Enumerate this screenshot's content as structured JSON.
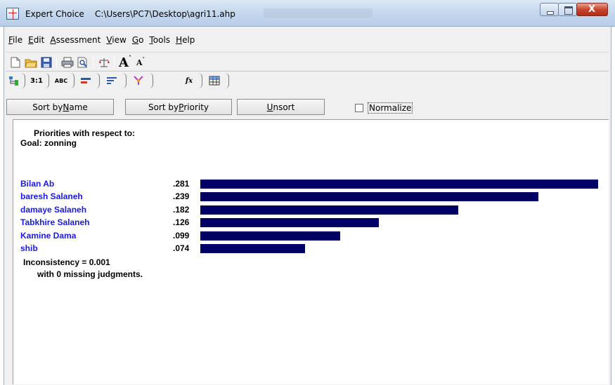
{
  "window": {
    "app_name": "Expert Choice",
    "file_path": "C:\\Users\\PC7\\Desktop\\agri11.ahp"
  },
  "menu": {
    "items": [
      {
        "label": "File",
        "accel": "F",
        "rest": "ile"
      },
      {
        "label": "Edit",
        "accel": "E",
        "rest": "dit"
      },
      {
        "label": "Assessment",
        "accel": "A",
        "rest": "ssessment"
      },
      {
        "label": "View",
        "accel": "V",
        "rest": "iew"
      },
      {
        "label": "Go",
        "accel": "G",
        "rest": "o"
      },
      {
        "label": "Tools",
        "accel": "T",
        "rest": "ools"
      },
      {
        "label": "Help",
        "accel": "H",
        "rest": "elp"
      }
    ]
  },
  "toolbar": {
    "icons": [
      "new-file-icon",
      "open-folder-icon",
      "save-icon",
      "print-icon",
      "print-preview-icon",
      "balance-icon",
      "font-increase-icon",
      "font-decrease-icon"
    ]
  },
  "tabs": {
    "tree_icon": "tree-view-icon",
    "pairwise_label": "3:1",
    "verbal_label": "ABC",
    "icons": [
      "graphical-compare-icon",
      "bar-priorities-icon",
      "model-icon",
      "formula-icon",
      "data-grid-icon"
    ],
    "formula_glyph": "fx"
  },
  "sort_bar": {
    "sort_by_name": {
      "pre": "Sort by ",
      "accel": "N",
      "post": "ame"
    },
    "sort_by_priority": {
      "pre": "Sort by ",
      "accel": "P",
      "post": "riority"
    },
    "unsort": {
      "pre": "",
      "accel": "U",
      "post": "nsort"
    },
    "normalize_label": "Normalize",
    "normalize_checked": false
  },
  "panel": {
    "priorities_heading": "Priorities with respect to:",
    "goal_line": "Goal: zonning",
    "inconsistency": "Inconsistency = 0.001",
    "missing_judgments": "with 0  missing judgments."
  },
  "chart_data": {
    "type": "bar",
    "orientation": "horizontal",
    "categories": [
      "Bilan Ab",
      "baresh Salaneh",
      "damaye Salaneh",
      "Tabkhire Salaneh",
      "Kamine Dama",
      "shib"
    ],
    "values": [
      0.281,
      0.239,
      0.182,
      0.126,
      0.099,
      0.074
    ],
    "value_labels": [
      ".281",
      ".239",
      ".182",
      ".126",
      ".099",
      ".074"
    ],
    "bar_color": "#000066",
    "label_color": "#1a1ae6"
  },
  "colors": {
    "bar": "#000066",
    "alternative_label": "#1a1ae6"
  }
}
